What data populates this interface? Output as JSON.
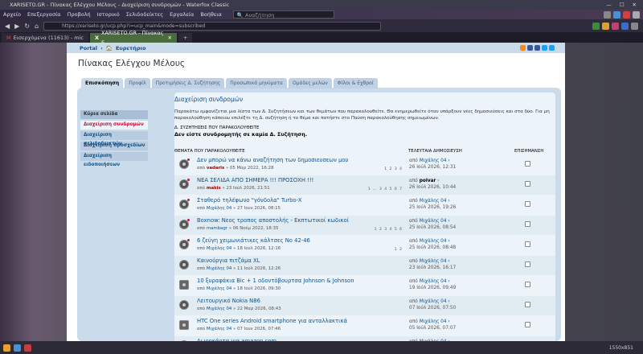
{
  "window": {
    "title": "XARISETO.GR - Πίνακας Ελέγχου Μέλους - Διαχείριση συνδρομών - Waterfox Classic"
  },
  "menu": [
    "Αρχείο",
    "Επεξεργασία",
    "Προβολή",
    "Ιστορικό",
    "Σελιδοδείκτες",
    "Εργαλεία",
    "Βοήθεια"
  ],
  "search_placeholder": "Αναζήτηση",
  "url": "https://xariseto.gr/ucp.php?i=ucp_main&mode=subscribed",
  "tabs": [
    {
      "label": "Εισερχόμενα (11613) - mic"
    },
    {
      "label": "XARISETO.GR - Πίνακας Ε"
    }
  ],
  "breadcrumb": {
    "portal": "Portal",
    "sep": "‹",
    "index": "Ευρετήριο"
  },
  "ucp_title": "Πίνακας Ελέγχου Μέλους",
  "page_tabs": [
    "Επισκόπηση",
    "Προφίλ",
    "Προτιμήσεις Δ. Συζήτησης",
    "Προσωπικά μηνύματα",
    "Ομάδες μελών",
    "Φίλοι & Εχθροί"
  ],
  "left_menu": [
    "Κύρια σελίδα",
    "Διαχείριση συνδρομών",
    "Διαχείριση σελιδοδεικτών",
    "Διαχείριση προσχεδίων",
    "Διαχείριση ειδοποιήσεων"
  ],
  "content": {
    "title": "Διαχείριση συνδρομών",
    "intro": "Παρακάτω εμφανίζεται μια λίστα των Δ. Συζητήσεων και των θεμάτων που παρακολουθείτε. Θα ενημερωθείτε όταν υπάρξουν νέες δημοσιεύσεις και στα δύο. Για μη παρακολούθηση κάποιου επιλέξτε τη Δ. συζήτηση ή το θέμα και πατήστε στο Παύση παρακολούθησης σημειωμένων.",
    "watched_forums_title": "Δ. ΣΥΖΗΤΗΣΕΙΣ ΠΟΥ ΠΑΡΑΚΟΛΟΥΘΕΙΤΕ",
    "watched_forums_none": "Δεν είστε συνδρομητής σε καμία Δ. Συζήτηση.",
    "col_topics": "ΘΕΜΑΤΑ ΠΟΥ ΠΑΡΑΚΟΛΟΥΘΕΙΤΕ",
    "col_last": "ΤΕΛΕΥΤΑΙΑ ΔΗΜΟΣΙΕΥΣΗ",
    "col_mark": "ΕΠΙΣΗΜΑΝΣΗ"
  },
  "topics": [
    {
      "title": "Δεν μπορώ να κάνω αναζήτηση των δημοσιευσεων μου",
      "by": "από",
      "author": "vadaris",
      "author_red": true,
      "date": "» 05 Μαρ 2022, 16:28",
      "pages": "1 2 3 4",
      "last_by": "Μιχάλης 04",
      "last_date": "26 Ιούλ 2026, 12:31",
      "last_bold": false,
      "icon": "dot"
    },
    {
      "title": "ΝΕΑ ΣΕΛΙΔΑ ΑΠΟ ΣΗΜΕΡΑ !!! ΠΡΟΣΟΧΗ !!!",
      "by": "από",
      "author": "makis",
      "author_red": true,
      "date": "» 23 Ιούλ 2026, 21:51",
      "pages": "1 … 3 4 5 6 7",
      "last_by": "polvar",
      "last_date": "26 Ιούλ 2026, 10:44",
      "last_bold": true,
      "icon": "dot"
    },
    {
      "title": "Σταθερό τηλέφωνο \"γόνδολα\" Turbo-X",
      "by": "από",
      "author": "Μιχάλης 04",
      "author_red": false,
      "date": "» 27 Ιουν 2026, 08:15",
      "pages": "",
      "last_by": "Μιχάλης 04",
      "last_date": "25 Ιούλ 2026, 19:26",
      "last_bold": false,
      "icon": "dot"
    },
    {
      "title": "Boxnow: Νεος τροπος αποστολής - Εκπτωτικοί κωδικοί",
      "by": "από",
      "author": "mambagr",
      "author_red": false,
      "date": "» 06 Νοέμ 2022, 18:35",
      "pages": "1 2 3 4 5 6",
      "last_by": "Μιχάλης 04",
      "last_date": "25 Ιούλ 2026, 08:54",
      "last_bold": false,
      "icon": "dot"
    },
    {
      "title": "6 ζεύγη χειμωνιάτικες κάλτσες Νο 42-46",
      "by": "από",
      "author": "Μιχάλης 04",
      "author_red": false,
      "date": "» 18 Ιούλ 2026, 12:16",
      "pages": "1 2",
      "last_by": "Μιχάλης 04",
      "last_date": "25 Ιούλ 2026, 08:48",
      "last_bold": false,
      "icon": "dot"
    },
    {
      "title": "Καινούργια πιτζάμα XL",
      "by": "από",
      "author": "Μιχάλης 04",
      "author_red": false,
      "date": "» 11 Ιούλ 2026, 12:26",
      "pages": "",
      "last_by": "Μιχάλης 04",
      "last_date": "23 Ιούλ 2026, 16:17",
      "last_bold": false,
      "icon": "plain"
    },
    {
      "title": "10 ξυραφάκια Bic + 1 οδοντόβουρτσα Johnson & Johnson",
      "by": "από",
      "author": "Μιχάλης 04",
      "author_red": false,
      "date": "» 18 Ιούλ 2026, 09:30",
      "pages": "",
      "last_by": "Μιχάλης 04",
      "last_date": "19 Ιούλ 2026, 09:49",
      "last_bold": false,
      "icon": "list"
    },
    {
      "title": "Λειτουργικό Nokia N86",
      "by": "από",
      "author": "Μιχάλης 04",
      "author_red": false,
      "date": "» 22 Μαρ 2026, 08:43",
      "pages": "",
      "last_by": "Μιχάλης 04",
      "last_date": "07 Ιούλ 2026, 07:50",
      "last_bold": false,
      "icon": "plain"
    },
    {
      "title": "HTC One series Android smartphone για ανταλλακτικά",
      "by": "από",
      "author": "Μιχάλης 04",
      "author_red": false,
      "date": "» 07 Ιουν 2026, 07:46",
      "pages": "",
      "last_by": "Μιχάλης 04",
      "last_date": "05 Ιούλ 2026, 07:07",
      "last_bold": false,
      "icon": "list"
    },
    {
      "title": "Δωροκάρτα για amazon.com",
      "by": "από",
      "author": "Μιχάλης 04",
      "author_red": false,
      "date": "» 22 Μαρ 2026, 09:06",
      "pages": "",
      "last_by": "Μιχάλης 04",
      "last_date": "04 Ιούλ 2026, 10:26",
      "last_bold": false,
      "icon": "plain"
    }
  ],
  "statusbar": {
    "resolution": "1550x851"
  },
  "colors": {
    "link": "#105289",
    "panel": "#cadceb",
    "row": "#ecf3f9",
    "row_alt": "#e1ebf2",
    "active_menu": "#d31141"
  }
}
